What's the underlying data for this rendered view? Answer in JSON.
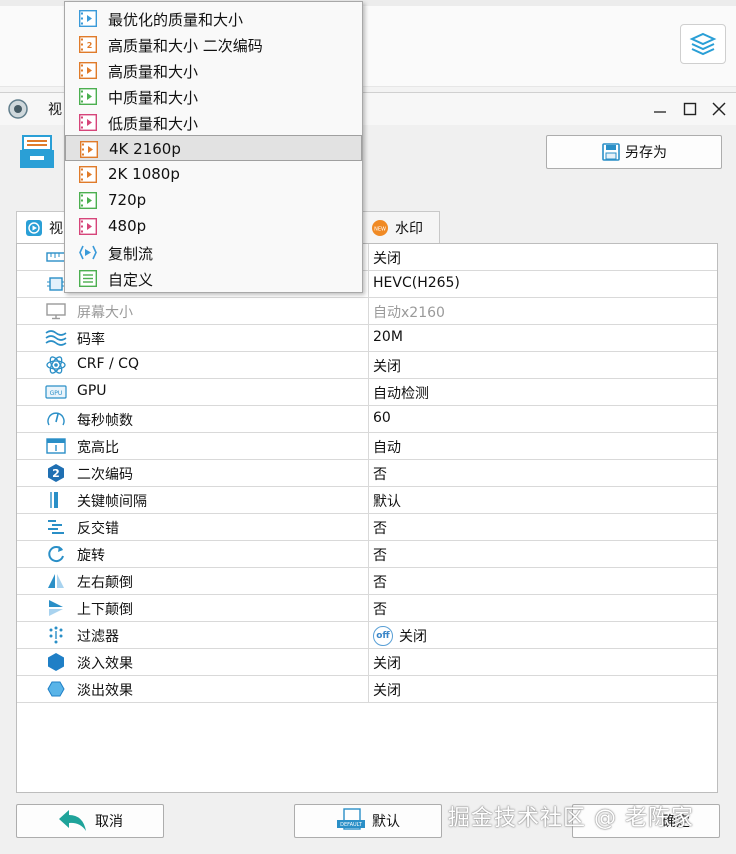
{
  "window": {
    "title": "视"
  },
  "toolbar": {
    "save_as_label": "另存为"
  },
  "tabs": [
    {
      "label": "视",
      "active": true
    },
    {
      "label": "水印",
      "active": false
    }
  ],
  "settings": [
    {
      "name": "",
      "value": "关闭",
      "icon": "ruler-icon"
    },
    {
      "name": "",
      "value": "HEVC(H265)",
      "icon": "chip-icon"
    },
    {
      "name": "屏幕大小",
      "value": "自动x2160",
      "icon": "monitor-icon",
      "disabled": true
    },
    {
      "name": "码率",
      "value": "20M",
      "icon": "waves-icon"
    },
    {
      "name": "CRF / CQ",
      "value": "关闭",
      "icon": "atom-icon"
    },
    {
      "name": "GPU",
      "value": "自动检测",
      "icon": "gpu-icon"
    },
    {
      "name": "每秒帧数",
      "value": "60",
      "icon": "gauge-icon"
    },
    {
      "name": "宽高比",
      "value": "自动",
      "icon": "aspect-icon"
    },
    {
      "name": "二次编码",
      "value": "否",
      "icon": "two-pass-icon"
    },
    {
      "name": "关键帧间隔",
      "value": "默认",
      "icon": "keyframe-icon"
    },
    {
      "name": "反交错",
      "value": "否",
      "icon": "deinterlace-icon"
    },
    {
      "name": "旋转",
      "value": "否",
      "icon": "rotate-icon"
    },
    {
      "name": "左右颠倒",
      "value": "否",
      "icon": "flip-horizontal-icon"
    },
    {
      "name": "上下颠倒",
      "value": "否",
      "icon": "flip-vertical-icon"
    },
    {
      "name": "过滤器",
      "value": "关闭",
      "icon": "filter-icon",
      "badge": "off"
    },
    {
      "name": "淡入效果",
      "value": "关闭",
      "icon": "fade-in-icon"
    },
    {
      "name": "淡出效果",
      "value": "关闭",
      "icon": "fade-out-icon"
    }
  ],
  "buttons": {
    "cancel": "取消",
    "default": "默认",
    "default_icon_text": "DEFAULT",
    "ok": "确定"
  },
  "menu": {
    "items": [
      {
        "label": "最优化的质量和大小",
        "color": "#3a9ad9"
      },
      {
        "label": "高质量和大小 二次编码",
        "color": "#e07b2a"
      },
      {
        "label": "高质量和大小",
        "color": "#e07b2a"
      },
      {
        "label": "中质量和大小",
        "color": "#4caf50"
      },
      {
        "label": "低质量和大小",
        "color": "#d6457a"
      },
      {
        "label": "4K 2160p",
        "color": "#e07b2a",
        "selected": true
      },
      {
        "label": "2K 1080p",
        "color": "#e07b2a"
      },
      {
        "label": "720p",
        "color": "#4caf50"
      },
      {
        "label": "480p",
        "color": "#d6457a"
      },
      {
        "label": "复制流",
        "color": "#3a9ad9"
      },
      {
        "label": "自定义",
        "color": "#4caf50"
      }
    ]
  },
  "watermark": "掘金技术社区 @ 老陈家"
}
